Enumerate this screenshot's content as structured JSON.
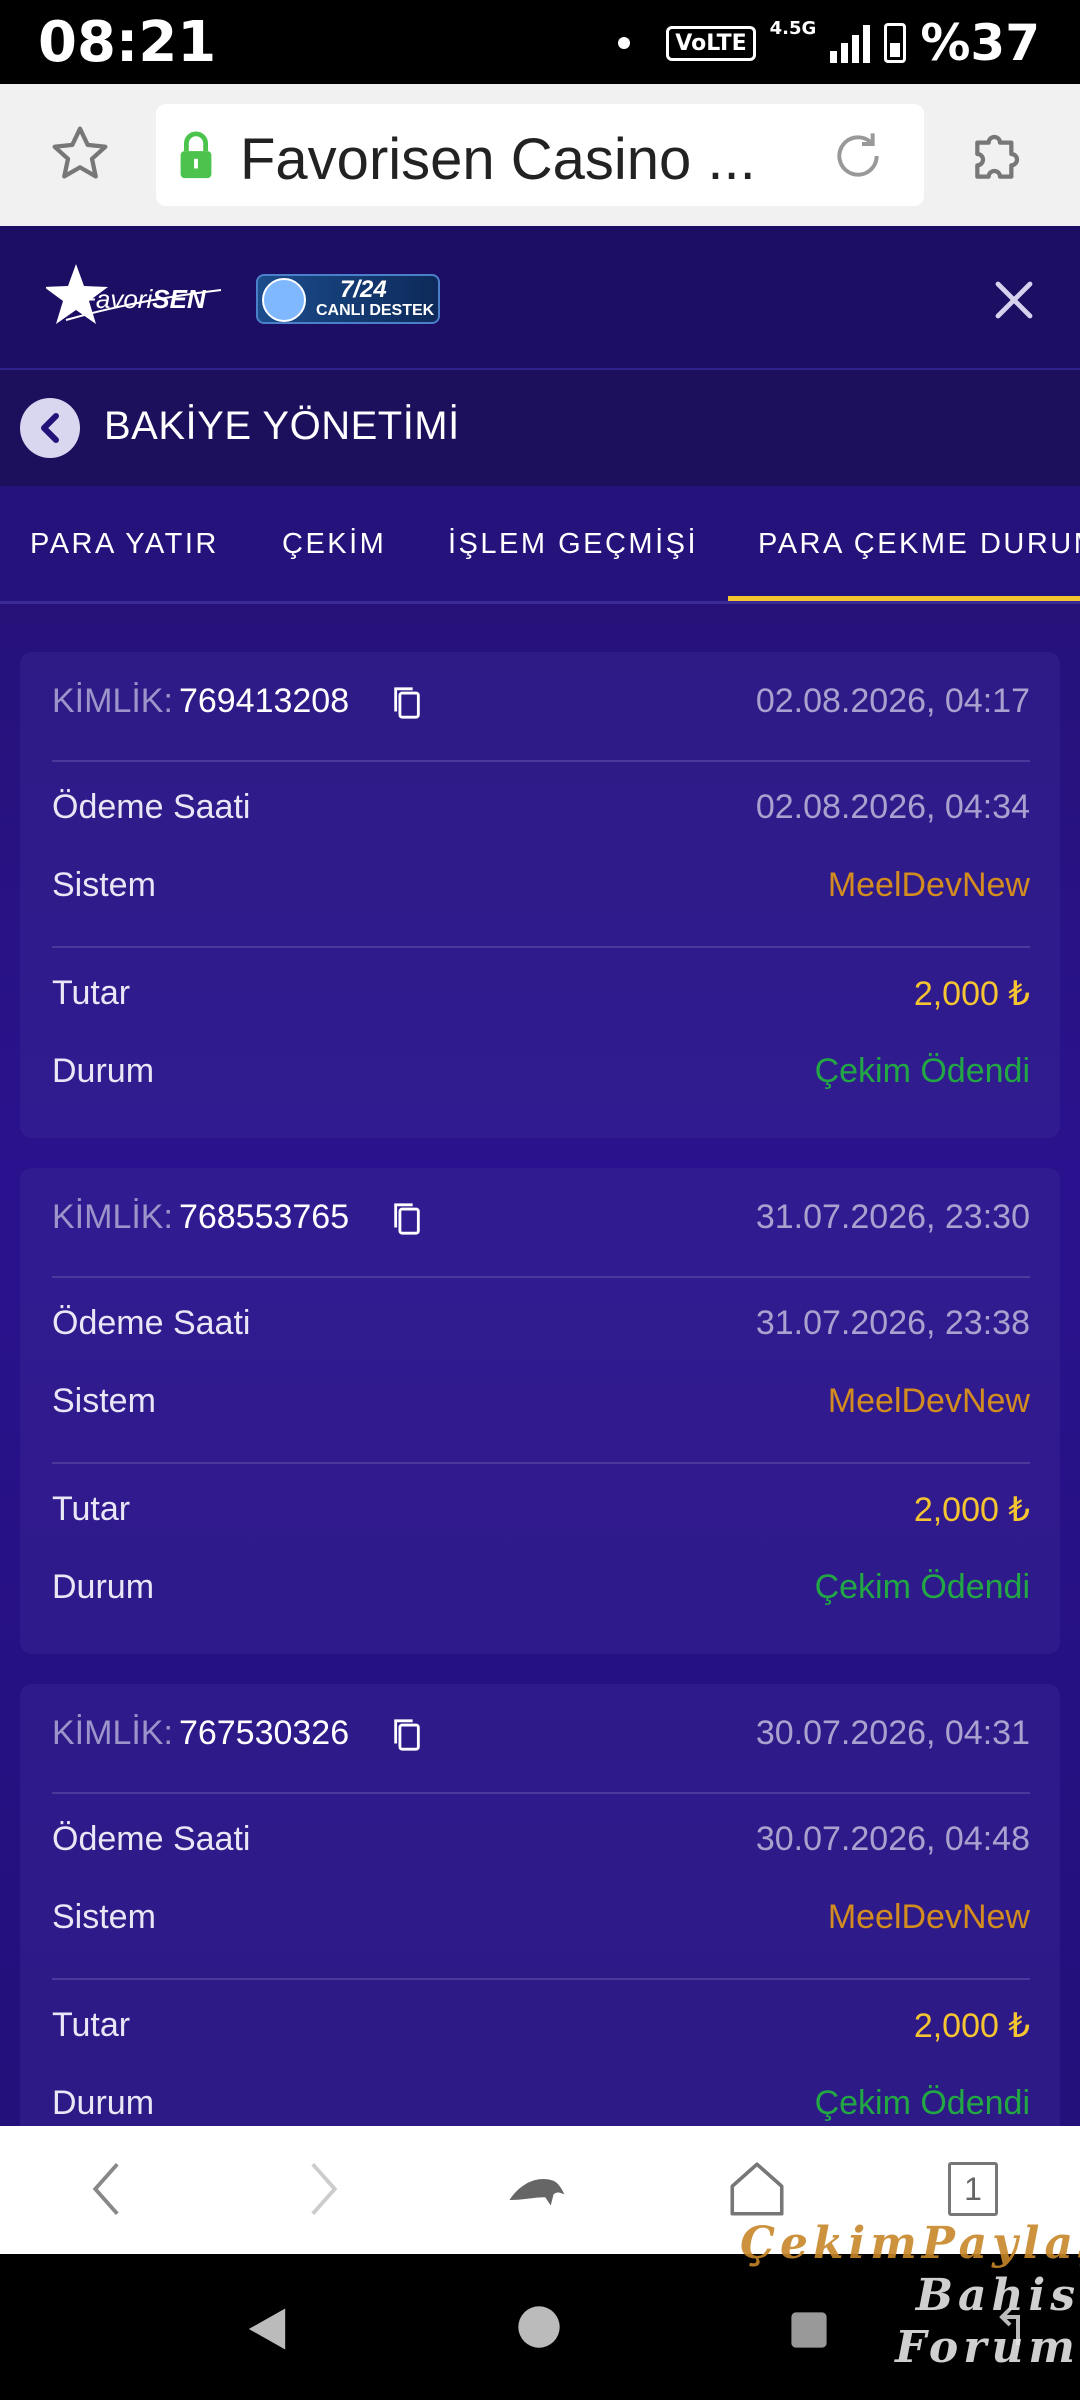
{
  "status_bar": {
    "time": "08:21",
    "network": "VoLTE",
    "network_type": "4.5G",
    "battery": "%37"
  },
  "browser": {
    "url_title": "Favorisen Casino ...",
    "tab_count": "1"
  },
  "site": {
    "logo_text_a": "Favori",
    "logo_text_b": "SEN",
    "support_time": "7/24",
    "support_label": "CANLI DESTEK",
    "page_title": "BAKİYE YÖNETİMİ",
    "tabs": [
      {
        "label": "PARA YATIR",
        "active": false
      },
      {
        "label": "ÇEKİM",
        "active": false
      },
      {
        "label": "İŞLEM GEÇMİŞİ",
        "active": false
      },
      {
        "label": "PARA ÇEKME DURUMU",
        "active": true
      }
    ]
  },
  "labels": {
    "kimlik": "KİMLİK:",
    "odeme_saati": "Ödeme Saati",
    "sistem": "Sistem",
    "tutar": "Tutar",
    "durum": "Durum"
  },
  "withdrawals": [
    {
      "id": "769413208",
      "created": "02.08.2026, 04:17",
      "paid_at": "02.08.2026, 04:34",
      "system": "MeelDevNew",
      "amount": "2,000 ₺",
      "status": "Çekim Ödendi"
    },
    {
      "id": "768553765",
      "created": "31.07.2026, 23:30",
      "paid_at": "31.07.2026, 23:38",
      "system": "MeelDevNew",
      "amount": "2,000 ₺",
      "status": "Çekim Ödendi"
    },
    {
      "id": "767530326",
      "created": "30.07.2026, 04:31",
      "paid_at": "30.07.2026, 04:48",
      "system": "MeelDevNew",
      "amount": "2,000 ₺",
      "status": "Çekim Ödendi"
    }
  ],
  "watermark": {
    "line1": "ÇekimPaylaş",
    "line2": "Bahis Forum"
  },
  "colors": {
    "accent_yellow": "#f5c431",
    "system_orange": "#d38c1f",
    "status_green": "#22a744",
    "background_purple": "#2a128e"
  }
}
